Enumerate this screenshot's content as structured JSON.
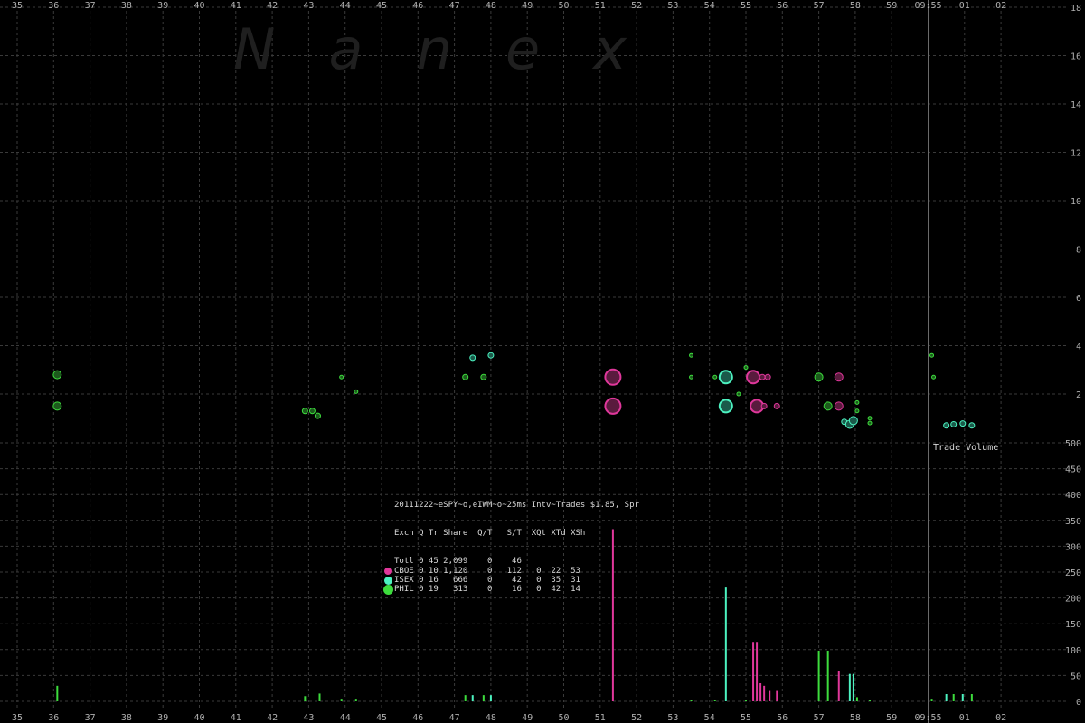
{
  "colors": {
    "CBOE": "#e0379b",
    "ISEX": "#4cf2c0",
    "PHIL": "#3ddc3d",
    "background": "#000000",
    "grid": "#3a3a3a"
  },
  "watermark": "N   a   n   e   x",
  "stats": {
    "header": "20111222~eSPY~o,eIWM~o~25ms Intv~Trades $1.85, Spr",
    "columns": "Exch Q Tr Share  Q/T   S/T  XQt XTd XSh",
    "rows": [
      {
        "exch": "Totl",
        "text": "Totl 0 45 2,099    0    46",
        "marker": null
      },
      {
        "exch": "CBOE",
        "text": "CBOE 0 10 1,120    0   112   0  22  53",
        "marker": "CBOE"
      },
      {
        "exch": "ISEX",
        "text": "ISEX 0 16   666    0    42   0  35  31",
        "marker": "ISEX"
      },
      {
        "exch": "PHIL",
        "text": "PHIL 0 19   313    0    16   0  42  14",
        "marker": "PHIL"
      }
    ]
  },
  "chart_data": {
    "type": "scatter",
    "x_ticks_top": [
      "35",
      "36",
      "37",
      "38",
      "39",
      "40",
      "41",
      "42",
      "43",
      "44",
      "45",
      "46",
      "47",
      "48",
      "49",
      "50",
      "51",
      "52",
      "53",
      "54",
      "55",
      "56",
      "57",
      "58",
      "59",
      "09:55",
      "01",
      "02"
    ],
    "x_ticks_bottom": [
      "35",
      "36",
      "37",
      "38",
      "39",
      "40",
      "41",
      "42",
      "43",
      "44",
      "45",
      "46",
      "47",
      "48",
      "49",
      "50",
      "51",
      "52",
      "53",
      "54",
      "55",
      "56",
      "57",
      "58",
      "59",
      "09:55",
      "01",
      "02"
    ],
    "price_axis": {
      "ticks": [
        "18",
        "16",
        "14",
        "12",
        "10",
        "8",
        "6",
        "4",
        "2"
      ],
      "ylim": [
        0,
        18
      ]
    },
    "volume_axis": {
      "label": "Trade Volume",
      "ticks": [
        "500",
        "450",
        "400",
        "350",
        "300",
        "250",
        "200",
        "150",
        "100",
        "50",
        "0"
      ],
      "ylim": [
        0,
        500
      ]
    },
    "trades": [
      {
        "x": 36.1,
        "y": 2.8,
        "exch": "PHIL",
        "size": 2
      },
      {
        "x": 36.1,
        "y": 1.5,
        "exch": "PHIL",
        "size": 2
      },
      {
        "x": 42.9,
        "y": 1.3,
        "exch": "PHIL",
        "size": 1
      },
      {
        "x": 43.1,
        "y": 1.3,
        "exch": "PHIL",
        "size": 1
      },
      {
        "x": 43.25,
        "y": 1.1,
        "exch": "PHIL",
        "size": 1
      },
      {
        "x": 43.9,
        "y": 2.7,
        "exch": "PHIL",
        "size": 0
      },
      {
        "x": 44.3,
        "y": 2.1,
        "exch": "PHIL",
        "size": 0
      },
      {
        "x": 47.3,
        "y": 2.7,
        "exch": "PHIL",
        "size": 1
      },
      {
        "x": 47.5,
        "y": 3.5,
        "exch": "ISEX",
        "size": 1
      },
      {
        "x": 47.8,
        "y": 2.7,
        "exch": "PHIL",
        "size": 1
      },
      {
        "x": 48.0,
        "y": 3.6,
        "exch": "ISEX",
        "size": 1
      },
      {
        "x": 51.35,
        "y": 2.7,
        "exch": "CBOE",
        "size": 4
      },
      {
        "x": 51.35,
        "y": 1.5,
        "exch": "CBOE",
        "size": 4
      },
      {
        "x": 53.5,
        "y": 3.6,
        "exch": "PHIL",
        "size": 0
      },
      {
        "x": 53.5,
        "y": 2.7,
        "exch": "PHIL",
        "size": 0
      },
      {
        "x": 54.15,
        "y": 2.7,
        "exch": "PHIL",
        "size": 0
      },
      {
        "x": 54.45,
        "y": 2.7,
        "exch": "ISEX",
        "size": 3
      },
      {
        "x": 54.45,
        "y": 1.5,
        "exch": "ISEX",
        "size": 3
      },
      {
        "x": 54.8,
        "y": 2.0,
        "exch": "PHIL",
        "size": 0
      },
      {
        "x": 55.0,
        "y": 3.1,
        "exch": "PHIL",
        "size": 0
      },
      {
        "x": 55.2,
        "y": 2.7,
        "exch": "CBOE",
        "size": 3
      },
      {
        "x": 55.3,
        "y": 1.5,
        "exch": "CBOE",
        "size": 3
      },
      {
        "x": 55.45,
        "y": 2.7,
        "exch": "CBOE",
        "size": 1
      },
      {
        "x": 55.6,
        "y": 2.7,
        "exch": "CBOE",
        "size": 1
      },
      {
        "x": 55.5,
        "y": 1.5,
        "exch": "CBOE",
        "size": 1
      },
      {
        "x": 55.85,
        "y": 1.5,
        "exch": "CBOE",
        "size": 1
      },
      {
        "x": 57.0,
        "y": 2.7,
        "exch": "PHIL",
        "size": 2
      },
      {
        "x": 57.55,
        "y": 2.7,
        "exch": "CBOE",
        "size": 2
      },
      {
        "x": 57.25,
        "y": 1.5,
        "exch": "PHIL",
        "size": 2
      },
      {
        "x": 57.55,
        "y": 1.5,
        "exch": "CBOE",
        "size": 2
      },
      {
        "x": 58.05,
        "y": 1.65,
        "exch": "PHIL",
        "size": 0
      },
      {
        "x": 58.05,
        "y": 1.3,
        "exch": "PHIL",
        "size": 0
      },
      {
        "x": 57.7,
        "y": 0.85,
        "exch": "ISEX",
        "size": 1
      },
      {
        "x": 57.85,
        "y": 0.75,
        "exch": "ISEX",
        "size": 2
      },
      {
        "x": 57.95,
        "y": 0.9,
        "exch": "ISEX",
        "size": 2
      },
      {
        "x": 58.4,
        "y": 1.0,
        "exch": "PHIL",
        "size": 0
      },
      {
        "x": 58.4,
        "y": 0.8,
        "exch": "PHIL",
        "size": 0
      },
      {
        "x": 60.1,
        "y": 3.6,
        "exch": "PHIL",
        "size": 0
      },
      {
        "x": 60.15,
        "y": 2.7,
        "exch": "PHIL",
        "size": 0
      },
      {
        "x": 60.5,
        "y": 0.7,
        "exch": "ISEX",
        "size": 1
      },
      {
        "x": 60.7,
        "y": 0.75,
        "exch": "ISEX",
        "size": 1
      },
      {
        "x": 60.95,
        "y": 0.78,
        "exch": "ISEX",
        "size": 1
      },
      {
        "x": 61.2,
        "y": 0.7,
        "exch": "ISEX",
        "size": 1
      }
    ],
    "volumes": [
      {
        "x": 36.1,
        "v": 30,
        "exch": "PHIL"
      },
      {
        "x": 42.9,
        "v": 10,
        "exch": "PHIL"
      },
      {
        "x": 43.3,
        "v": 15,
        "exch": "PHIL"
      },
      {
        "x": 43.9,
        "v": 5,
        "exch": "PHIL"
      },
      {
        "x": 44.3,
        "v": 5,
        "exch": "PHIL"
      },
      {
        "x": 47.3,
        "v": 12,
        "exch": "PHIL"
      },
      {
        "x": 47.5,
        "v": 12,
        "exch": "ISEX"
      },
      {
        "x": 47.8,
        "v": 12,
        "exch": "PHIL"
      },
      {
        "x": 48.0,
        "v": 12,
        "exch": "ISEX"
      },
      {
        "x": 51.35,
        "v": 333,
        "exch": "CBOE"
      },
      {
        "x": 53.5,
        "v": 3,
        "exch": "PHIL"
      },
      {
        "x": 54.15,
        "v": 3,
        "exch": "PHIL"
      },
      {
        "x": 54.45,
        "v": 220,
        "exch": "ISEX"
      },
      {
        "x": 55.0,
        "v": 3,
        "exch": "PHIL"
      },
      {
        "x": 55.2,
        "v": 115,
        "exch": "CBOE"
      },
      {
        "x": 55.3,
        "v": 115,
        "exch": "CBOE"
      },
      {
        "x": 55.4,
        "v": 35,
        "exch": "CBOE"
      },
      {
        "x": 55.5,
        "v": 30,
        "exch": "CBOE"
      },
      {
        "x": 55.65,
        "v": 20,
        "exch": "CBOE"
      },
      {
        "x": 55.85,
        "v": 20,
        "exch": "CBOE"
      },
      {
        "x": 57.0,
        "v": 98,
        "exch": "PHIL"
      },
      {
        "x": 57.25,
        "v": 98,
        "exch": "PHIL"
      },
      {
        "x": 57.55,
        "v": 58,
        "exch": "CBOE"
      },
      {
        "x": 57.85,
        "v": 53,
        "exch": "ISEX"
      },
      {
        "x": 57.95,
        "v": 53,
        "exch": "ISEX"
      },
      {
        "x": 58.05,
        "v": 8,
        "exch": "PHIL"
      },
      {
        "x": 58.4,
        "v": 3,
        "exch": "PHIL"
      },
      {
        "x": 60.1,
        "v": 5,
        "exch": "PHIL"
      },
      {
        "x": 60.5,
        "v": 14,
        "exch": "ISEX"
      },
      {
        "x": 60.7,
        "v": 14,
        "exch": "PHIL"
      },
      {
        "x": 60.95,
        "v": 14,
        "exch": "ISEX"
      },
      {
        "x": 61.2,
        "v": 14,
        "exch": "PHIL"
      }
    ],
    "vertical_marker_x": 60.0
  }
}
